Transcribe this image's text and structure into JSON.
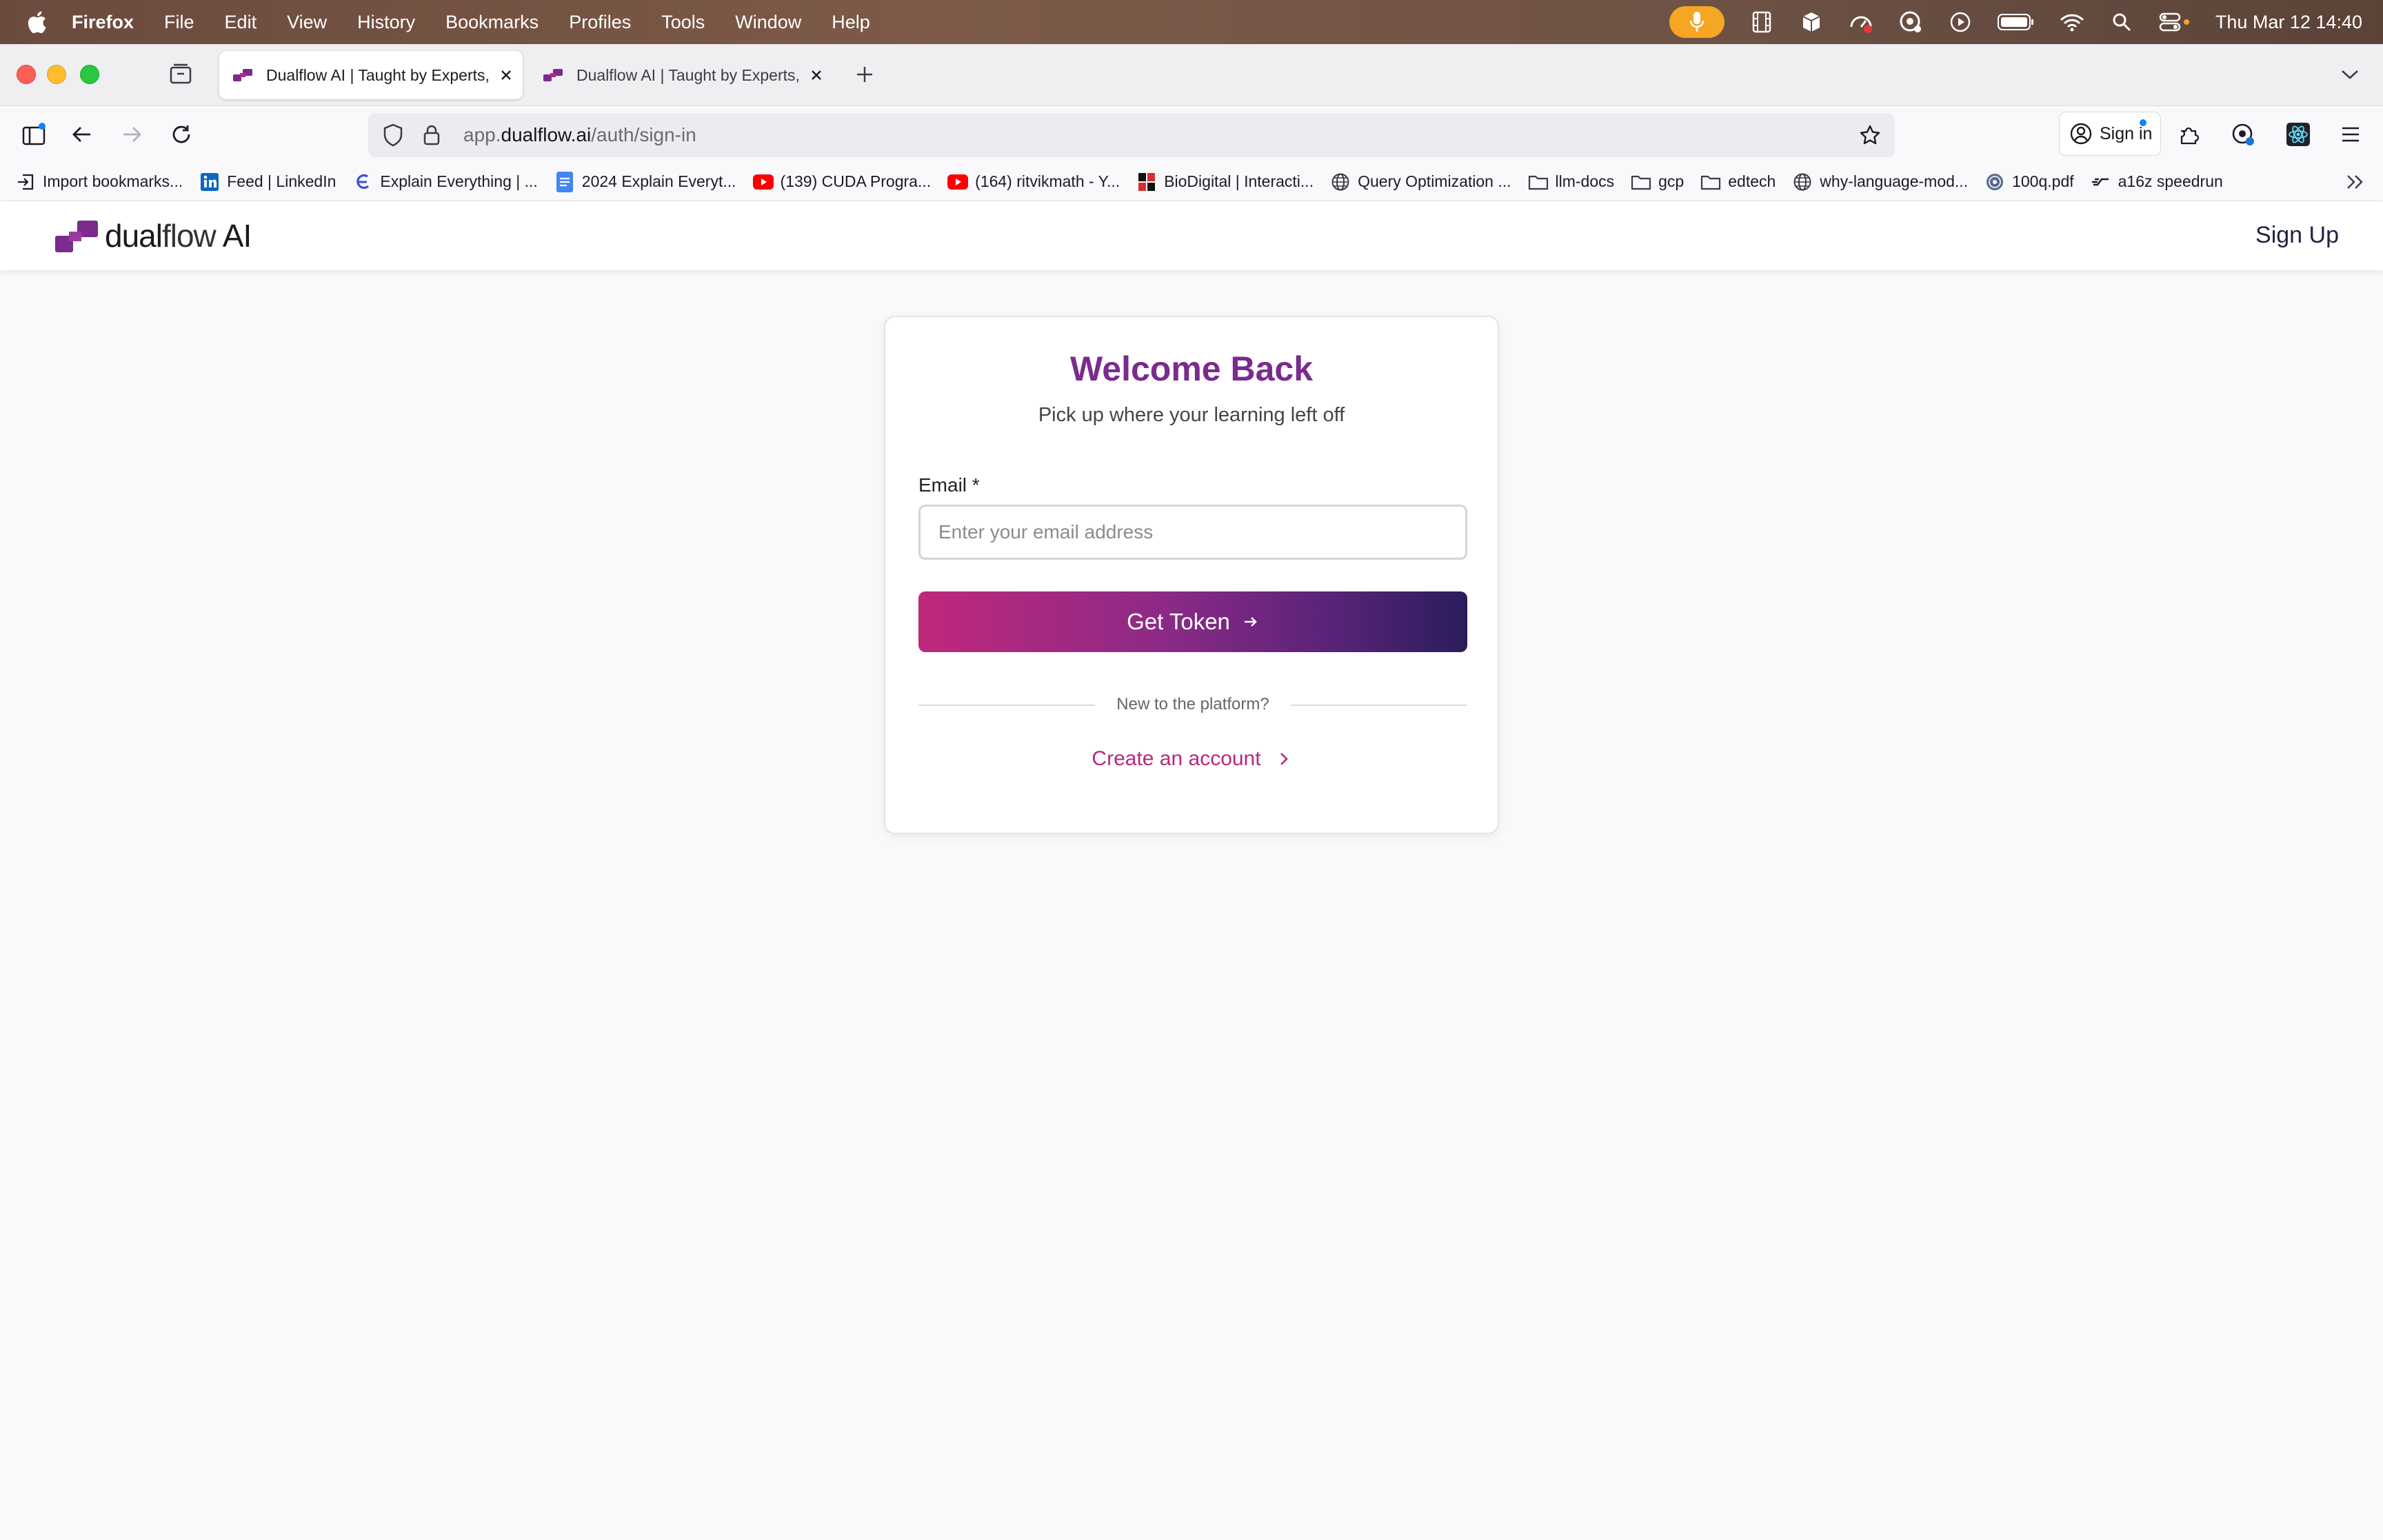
{
  "menubar": {
    "app": "Firefox",
    "items": [
      "File",
      "Edit",
      "View",
      "History",
      "Bookmarks",
      "Profiles",
      "Tools",
      "Window",
      "Help"
    ],
    "clock": "Thu Mar 12  14:40"
  },
  "tabs": [
    {
      "label": "Dualflow AI | Taught by Experts,",
      "active": true
    },
    {
      "label": "Dualflow AI | Taught by Experts,",
      "active": false
    }
  ],
  "urlbar": {
    "prefix": "app.",
    "domain": "dualflow.ai",
    "path": "/auth/sign-in"
  },
  "toolbar": {
    "signin_label": "Sign in"
  },
  "bookmarks": [
    {
      "label": "Import bookmarks...",
      "icon": "import-icon"
    },
    {
      "label": "Feed | LinkedIn",
      "icon": "linkedin-icon"
    },
    {
      "label": "Explain Everything | ...",
      "icon": "explain-everything-icon"
    },
    {
      "label": "2024 Explain Everyt...",
      "icon": "docs-icon"
    },
    {
      "label": "(139) CUDA Progra...",
      "icon": "youtube-icon"
    },
    {
      "label": "(164) ritvikmath - Y...",
      "icon": "youtube-icon"
    },
    {
      "label": "BioDigital | Interacti...",
      "icon": "biodigital-icon"
    },
    {
      "label": "Query Optimization ...",
      "icon": "globe-icon"
    },
    {
      "label": "llm-docs",
      "icon": "folder-icon"
    },
    {
      "label": "gcp",
      "icon": "folder-icon"
    },
    {
      "label": "edtech",
      "icon": "folder-icon"
    },
    {
      "label": "why-language-mod...",
      "icon": "globe-icon"
    },
    {
      "label": "100q.pdf",
      "icon": "pdf-seal-icon"
    },
    {
      "label": "a16z speedrun",
      "icon": "speedrun-icon"
    }
  ],
  "site": {
    "brand_dual": "dual",
    "brand_flow": "flow",
    "brand_ai": "AI",
    "signup": "Sign Up"
  },
  "card": {
    "title": "Welcome Back",
    "subtitle": "Pick up where your learning left off",
    "email_label": "Email *",
    "email_placeholder": "Enter your email address",
    "email_value": "",
    "button": "Get Token",
    "divider": "New to the platform?",
    "create": "Create an account"
  },
  "colors": {
    "title": "#7b2a8e",
    "link": "#b5287f",
    "button_start": "#c0287c",
    "button_end": "#2a1d5c"
  }
}
